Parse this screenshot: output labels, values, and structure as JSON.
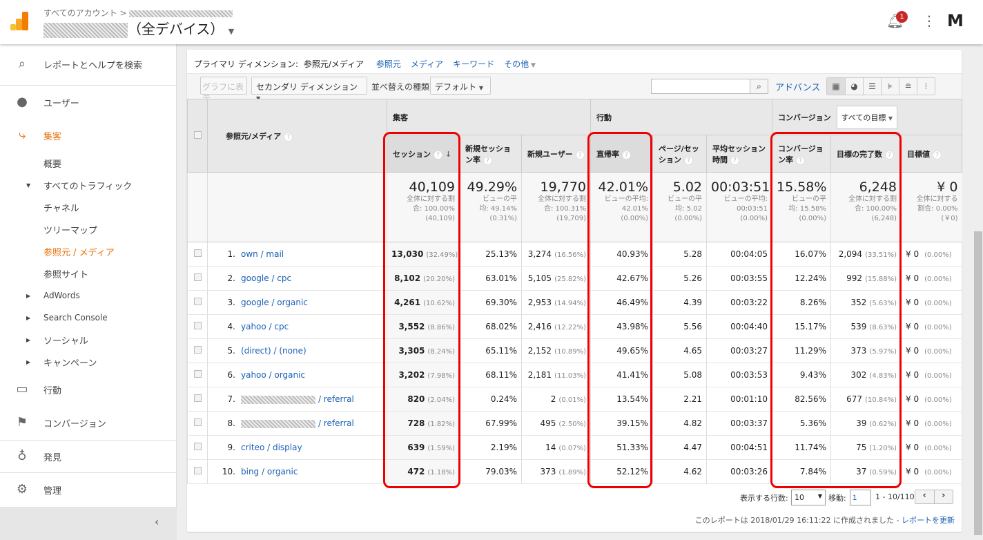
{
  "header": {
    "breadcrumb": "すべてのアカウント >",
    "property": "（全デバイス）",
    "notification_count": "1",
    "avatar": "M"
  },
  "sidebar": {
    "search": "レポートとヘルプを検索",
    "items": [
      {
        "label": "ユーザー",
        "icon": "person-icon"
      },
      {
        "label": "集客",
        "icon": "acquisition-icon"
      },
      {
        "label": "行動",
        "icon": "behavior-icon"
      },
      {
        "label": "コンバージョン",
        "icon": "flag-icon"
      },
      {
        "label": "発見",
        "icon": "lightbulb-icon"
      },
      {
        "label": "管理",
        "icon": "gear-icon"
      }
    ],
    "sub": [
      "概要",
      "すべてのトラフィック",
      "チャネル",
      "ツリーマップ",
      "参照元 / メディア",
      "参照サイト",
      "AdWords",
      "Search Console",
      "ソーシャル",
      "キャンペーン"
    ]
  },
  "dimensions": {
    "label": "プライマリ ディメンション:",
    "active": "参照元/メディア",
    "links": [
      "参照元",
      "メディア",
      "キーワード",
      "その他"
    ]
  },
  "toolbar": {
    "chart": "グラフに表示",
    "secondary": "セカンダリ ディメンション",
    "sort_label": "並べ替えの種類:",
    "sort": "デフォルト",
    "search_placeholder": "",
    "advanced": "アドバンス"
  },
  "table": {
    "dim_header": "参照元/メディア",
    "groups": [
      "集客",
      "行動",
      "コンバージョン"
    ],
    "goal_select": "すべての目標",
    "columns": [
      "セッション",
      "新規セッション率",
      "新規ユーザー",
      "直帰率",
      "ページ/セッション",
      "平均セッション時間",
      "コンバージョン率",
      "目標の完了数",
      "目標値"
    ],
    "summary": [
      {
        "v": "40,109",
        "l1": "全体に対する割",
        "l2": "合: 100.00%",
        "l3": "(40,109)"
      },
      {
        "v": "49.29%",
        "l1": "ビューの平",
        "l2": "均: 49.14%",
        "l3": "(0.31%)"
      },
      {
        "v": "19,770",
        "l1": "全体に対する割",
        "l2": "合: 100.31%",
        "l3": "(19,709)"
      },
      {
        "v": "42.01%",
        "l1": "ビューの平均:",
        "l2": "42.01%",
        "l3": "(0.00%)"
      },
      {
        "v": "5.02",
        "l1": "ビューの平",
        "l2": "均: 5.02",
        "l3": "(0.00%)"
      },
      {
        "v": "00:03:51",
        "l1": "ビューの平均:",
        "l2": "00:03:51",
        "l3": "(0.00%)"
      },
      {
        "v": "15.58%",
        "l1": "ビューの平",
        "l2": "均: 15.58%",
        "l3": "(0.00%)"
      },
      {
        "v": "6,248",
        "l1": "全体に対する割",
        "l2": "合: 100.00%",
        "l3": "(6,248)"
      },
      {
        "v": "¥ 0",
        "l1": "全体に対する",
        "l2": "割合: 0.00%",
        "l3": "(￥0)"
      }
    ],
    "rows": [
      [
        "1.",
        "own / mail",
        "13,030",
        "(32.49%)",
        "25.13%",
        "3,274",
        "(16.56%)",
        "40.93%",
        "5.28",
        "00:04:05",
        "16.07%",
        "2,094",
        "(33.51%)",
        "¥ 0",
        "(0.00%)"
      ],
      [
        "2.",
        "google / cpc",
        "8,102",
        "(20.20%)",
        "63.01%",
        "5,105",
        "(25.82%)",
        "42.67%",
        "5.26",
        "00:03:55",
        "12.24%",
        "992",
        "(15.88%)",
        "¥ 0",
        "(0.00%)"
      ],
      [
        "3.",
        "google / organic",
        "4,261",
        "(10.62%)",
        "69.30%",
        "2,953",
        "(14.94%)",
        "46.49%",
        "4.39",
        "00:03:22",
        "8.26%",
        "352",
        "(5.63%)",
        "¥ 0",
        "(0.00%)"
      ],
      [
        "4.",
        "yahoo / cpc",
        "3,552",
        "(8.86%)",
        "68.02%",
        "2,416",
        "(12.22%)",
        "43.98%",
        "5.56",
        "00:04:40",
        "15.17%",
        "539",
        "(8.63%)",
        "¥ 0",
        "(0.00%)"
      ],
      [
        "5.",
        "(direct) / (none)",
        "3,305",
        "(8.24%)",
        "65.11%",
        "2,152",
        "(10.89%)",
        "49.65%",
        "4.65",
        "00:03:27",
        "11.29%",
        "373",
        "(5.97%)",
        "¥ 0",
        "(0.00%)"
      ],
      [
        "6.",
        "yahoo / organic",
        "3,202",
        "(7.98%)",
        "68.11%",
        "2,181",
        "(11.03%)",
        "41.41%",
        "5.08",
        "00:03:53",
        "9.43%",
        "302",
        "(4.83%)",
        "¥ 0",
        "(0.00%)"
      ],
      [
        "7.",
        "/ referral",
        "820",
        "(2.04%)",
        "0.24%",
        "2",
        "(0.01%)",
        "13.54%",
        "2.21",
        "00:01:10",
        "82.56%",
        "677",
        "(10.84%)",
        "¥ 0",
        "(0.00%)"
      ],
      [
        "8.",
        "/ referral",
        "728",
        "(1.82%)",
        "67.99%",
        "495",
        "(2.50%)",
        "39.15%",
        "4.82",
        "00:03:37",
        "5.36%",
        "39",
        "(0.62%)",
        "¥ 0",
        "(0.00%)"
      ],
      [
        "9.",
        "criteo / display",
        "639",
        "(1.59%)",
        "2.19%",
        "14",
        "(0.07%)",
        "51.33%",
        "4.47",
        "00:04:51",
        "11.74%",
        "75",
        "(1.20%)",
        "¥ 0",
        "(0.00%)"
      ],
      [
        "10.",
        "bing / organic",
        "472",
        "(1.18%)",
        "79.03%",
        "373",
        "(1.89%)",
        "52.12%",
        "4.62",
        "00:03:26",
        "7.84%",
        "37",
        "(0.59%)",
        "¥ 0",
        "(0.00%)"
      ]
    ]
  },
  "footer": {
    "rows_label": "表示する行数:",
    "rows_value": "10",
    "goto_label": "移動:",
    "goto_value": "1",
    "range": "1 - 10/110",
    "generated": "このレポートは 2018/01/29 16:11:22 に作成されました - ",
    "refresh": "レポートを更新"
  },
  "colors": {
    "accent": "#e8710a",
    "link": "#1a5fb4",
    "highlight": "#e00000"
  }
}
